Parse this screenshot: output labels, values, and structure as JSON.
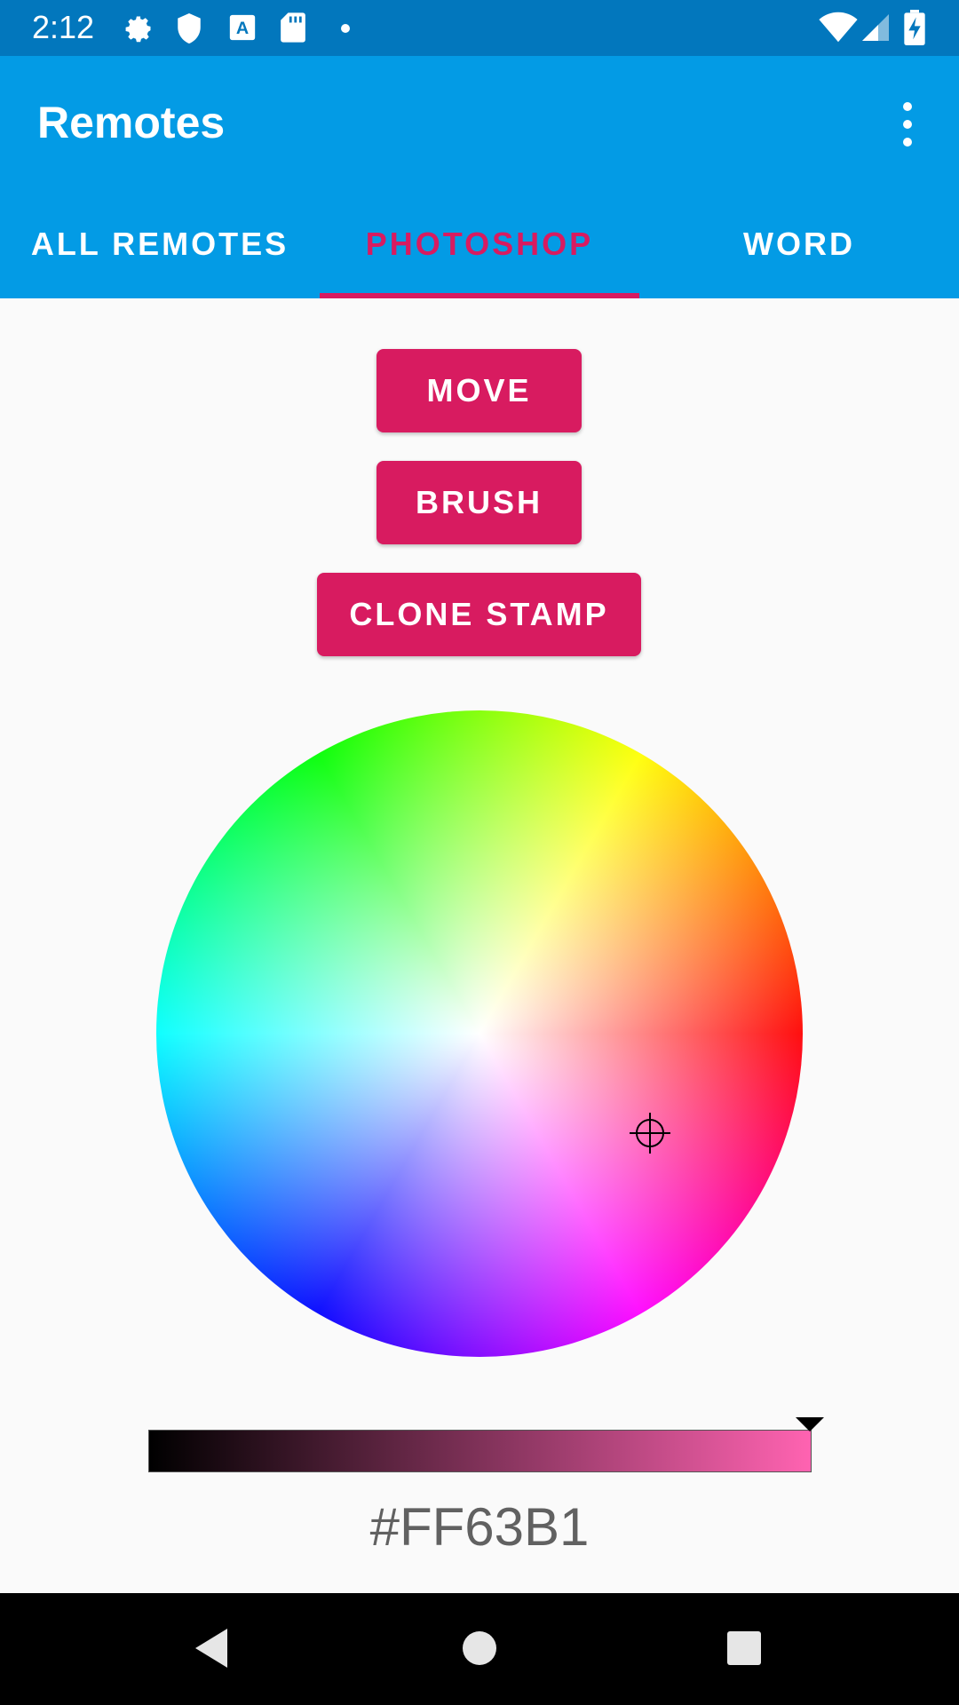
{
  "status_bar": {
    "time": "2:12",
    "left_icons": [
      "gear-icon",
      "shield-icon",
      "text-a-icon",
      "sd-card-icon",
      "dot-icon"
    ],
    "right_icons": [
      "wifi-icon",
      "signal-icon",
      "battery-charging-icon"
    ]
  },
  "app_bar": {
    "title": "Remotes",
    "menu_icon": "more-vert-icon"
  },
  "tabs": [
    {
      "label": "ALL REMOTES",
      "active": false
    },
    {
      "label": "PHOTOSHOP",
      "active": true
    },
    {
      "label": "WORD",
      "active": false
    }
  ],
  "buttons": {
    "move": "MOVE",
    "brush": "BRUSH",
    "clone_stamp": "CLONE STAMP"
  },
  "color_picker": {
    "selected_hex": "#FF63B1",
    "value_level": 1.0
  },
  "nav_bar": {
    "icons": [
      "back-icon",
      "home-icon",
      "recents-icon"
    ]
  },
  "colors": {
    "status_bar": "#0277bd",
    "app_bar": "#039be5",
    "accent": "#d81b60",
    "background": "#fafafa"
  }
}
